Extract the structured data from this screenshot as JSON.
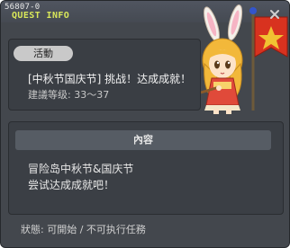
{
  "window": {
    "quest_id": "56807-0",
    "title": "QUEST INFO"
  },
  "quest": {
    "category_label": "活動",
    "title": "[中秋节国庆节] 挑战！达成成就！",
    "level_range": "建議等级: 33～37"
  },
  "content": {
    "header": "內容",
    "lines": [
      "冒险岛中秋节&国庆节",
      "尝试达成成就吧！"
    ]
  },
  "status": {
    "text": "狀態: 可開始 / 不可执行任務"
  },
  "colors": {
    "panel_bg": "#43474d",
    "title_accent": "#d9e85a",
    "flag_red": "#d8321f",
    "flag_star": "#f1c232"
  },
  "icons": {
    "close": "close-icon",
    "character": "bunny-girl-character-icon",
    "flag": "quest-flag-icon"
  }
}
